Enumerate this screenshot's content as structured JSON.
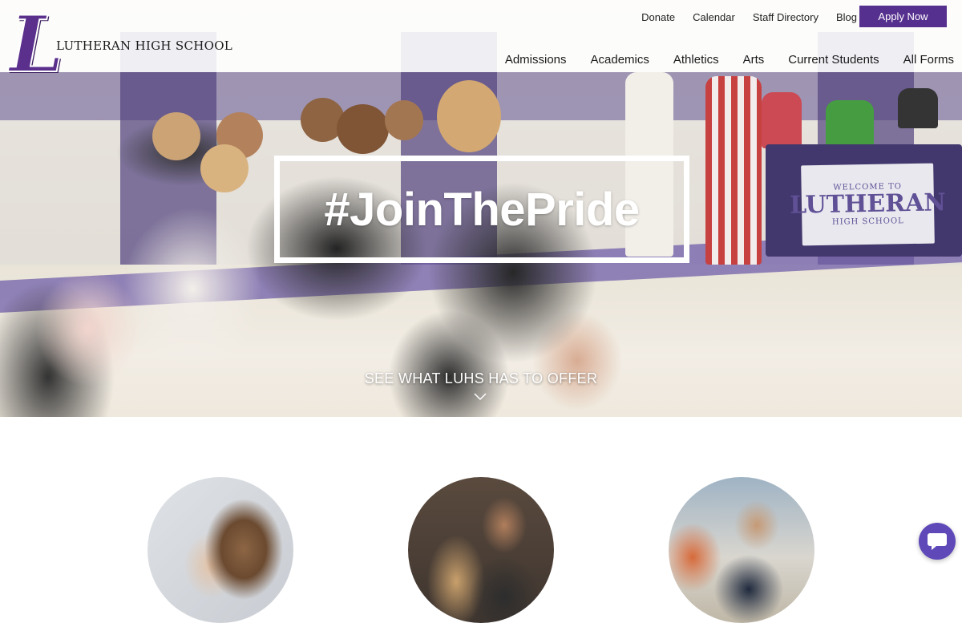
{
  "brand": {
    "logo_letter": "L",
    "name": "LUTHERAN HIGH SCHOOL",
    "color": "#56308f"
  },
  "utility_nav": {
    "items": [
      {
        "label": "Donate"
      },
      {
        "label": "Calendar"
      },
      {
        "label": "Staff Directory"
      },
      {
        "label": "Blog"
      }
    ],
    "apply_label": "Apply Now"
  },
  "main_nav": {
    "items": [
      {
        "label": "Admissions"
      },
      {
        "label": "Academics"
      },
      {
        "label": "Athletics"
      },
      {
        "label": "Arts"
      },
      {
        "label": "Current Students"
      },
      {
        "label": "All Forms"
      }
    ]
  },
  "hero": {
    "title": "#JoinThePride",
    "subtitle": "SEE WHAT LUHS HAS TO OFFER",
    "banner_small": "WELCOME TO",
    "banner_big": "LUTHERAN",
    "banner_bottom": "HIGH SCHOOL",
    "icon": "chevron-down-icon"
  },
  "features": {
    "items": [
      {
        "icon": "student-photo"
      },
      {
        "icon": "classroom-photo"
      },
      {
        "icon": "outdoor-photo"
      }
    ]
  },
  "chat": {
    "icon": "chat-bubble-icon",
    "color": "#5f49b8"
  }
}
